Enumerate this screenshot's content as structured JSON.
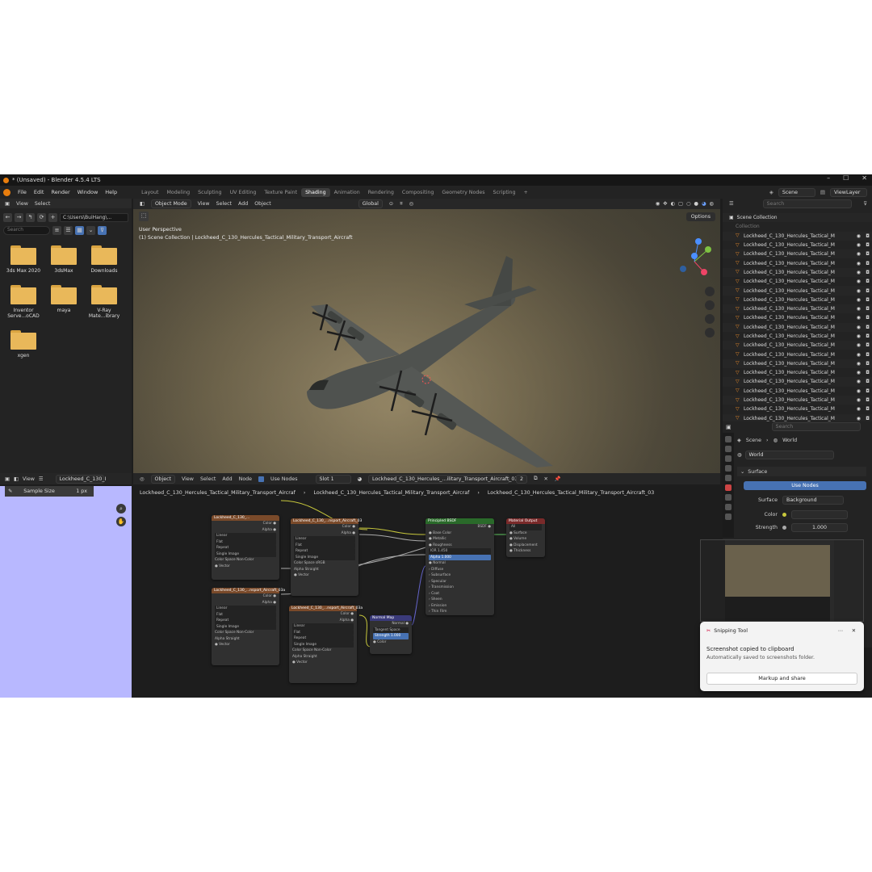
{
  "title": "* (Unsaved) - Blender 4.5.4 LTS",
  "menu": [
    "File",
    "Edit",
    "Render",
    "Window",
    "Help"
  ],
  "workspaces": [
    "Layout",
    "Modeling",
    "Sculpting",
    "UV Editing",
    "Texture Paint",
    "Shading",
    "Animation",
    "Rendering",
    "Compositing",
    "Geometry Nodes",
    "Scripting"
  ],
  "active_workspace": "Shading",
  "scene": "Scene",
  "view_layer": "ViewLayer",
  "file_browser": {
    "view": "View",
    "select": "Select",
    "path": "C:\\Users\\BuiHang\\...",
    "search_placeholder": "Search",
    "folders": [
      "3ds Max 2020",
      "3dsMax",
      "Downloads",
      "Inventor Serve...oCAD",
      "maya",
      "V-Ray Mate...ibrary",
      "xgen"
    ]
  },
  "viewport": {
    "mode": "Object Mode",
    "menu": [
      "View",
      "Select",
      "Add",
      "Object"
    ],
    "transform": "Global",
    "options": "Options",
    "perspective": "User Perspective",
    "collection_info": "(1) Scene Collection | Lockheed_C_130_Hercules_Tactical_Military_Transport_Aircraft"
  },
  "outliner": {
    "search_placeholder": "Search",
    "root": "Scene Collection",
    "collection": "Collection",
    "item": "Lockheed_C_130_Hercules_Tactical_M"
  },
  "properties": {
    "search_placeholder": "Search",
    "scene": "Scene",
    "world": "World",
    "world_name": "World",
    "surface_panel": "Surface",
    "use_nodes": "Use Nodes",
    "surface_label": "Surface",
    "surface_value": "Background",
    "color_label": "Color",
    "strength_label": "Strength",
    "strength_value": "1.000"
  },
  "node_editor": {
    "type": "Object",
    "menu": [
      "View",
      "Select",
      "Add",
      "Node"
    ],
    "use_nodes": "Use Nodes",
    "slot": "Slot 1",
    "material": "Lockheed_C_130_Hercules_...ilitary_Transport_Aircraft_03",
    "user_count": "2",
    "breadcrumb": [
      "Lockheed_C_130_Hercules_Tactical_Military_Transport_Aircraf",
      "Lockheed_C_130_Hercules_Tactical_Military_Transport_Aircraf",
      "Lockheed_C_130_Hercules_Tactical_Military_Transport_Aircraft_03"
    ],
    "nodes": {
      "img1": "Lockheed_C_130_...",
      "img2": "Lockheed_C_130_...nsport_Aircraft_03",
      "img3": "Lockheed_C_130_...nsport_Aircraft_03a",
      "img4": "Lockheed_C_130_...nsport_Aircraft_03a",
      "bsdf": "Principled BSDF",
      "output": "Material Output",
      "normal": "Normal Map"
    }
  },
  "uv_panel": {
    "view": "View",
    "image": "Lockheed_C_130_I",
    "sample_label": "Sample Size",
    "sample_value": "1 px"
  },
  "toast": {
    "app": "Snipping Tool",
    "title": "Screenshot copied to clipboard",
    "subtitle": "Automatically saved to screenshots folder.",
    "button": "Markup and share"
  }
}
